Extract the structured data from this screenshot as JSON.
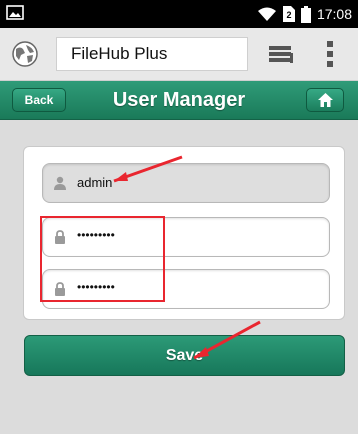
{
  "status_bar": {
    "time": "17:08",
    "sim_label": "2"
  },
  "browser": {
    "url_text": "FileHub Plus"
  },
  "header": {
    "back_label": "Back",
    "title": "User Manager"
  },
  "form": {
    "username_value": "admin",
    "password_value": "•••••••••",
    "confirm_password_value": "•••••••••"
  },
  "actions": {
    "save_label": "Save"
  },
  "colors": {
    "header_green": "#1f8563",
    "save_green": "#1f8563",
    "annotation_red": "#e9262f"
  },
  "icons": {
    "status_left": "image-icon",
    "wifi": "wifi-icon",
    "sim": "sim-icon",
    "battery": "battery-icon",
    "browser_logo": "globe-icon",
    "tabs": "tabs-icon",
    "menu": "overflow-menu-icon",
    "home": "home-icon",
    "user": "user-icon",
    "lock": "lock-icon"
  }
}
